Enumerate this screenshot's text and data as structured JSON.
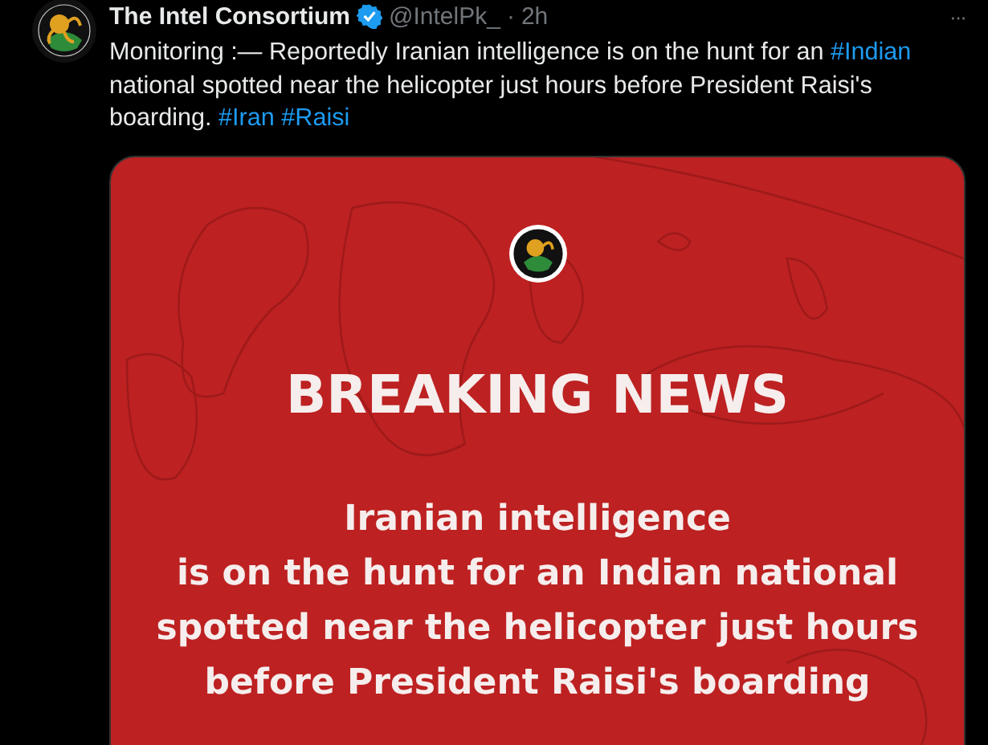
{
  "tweet": {
    "author": {
      "name": "The Intel Consortium",
      "verified": true,
      "handle": "@IntelPk_",
      "time": "2h",
      "separator": "·"
    },
    "more": "···",
    "text": [
      {
        "kind": "plain",
        "text": "Monitoring :— Reportedly Iranian intelligence is on the hunt for an "
      },
      {
        "kind": "hashtag",
        "text": "#Indian"
      },
      {
        "kind": "plain",
        "text": " national spotted near the helicopter just hours before President Raisi's boarding. "
      },
      {
        "kind": "hashtag",
        "text": "#Iran"
      },
      {
        "kind": "hashtag",
        "text": "#Raisi"
      }
    ],
    "media": {
      "headline": "BREAKING NEWS",
      "lines": [
        "Iranian intelligence",
        "is on the hunt for an Indian national",
        "spotted near the helicopter just hours",
        "before President Raisi's boarding"
      ]
    }
  }
}
